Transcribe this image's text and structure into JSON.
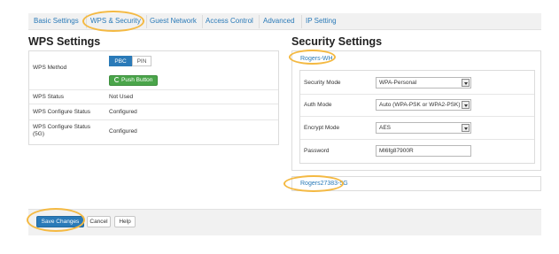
{
  "tabs": [
    {
      "label": "Basic Settings"
    },
    {
      "label": "WPS & Security"
    },
    {
      "label": "Guest Network"
    },
    {
      "label": "Access Control"
    },
    {
      "label": "Advanced"
    },
    {
      "label": "IP Setting"
    }
  ],
  "wps": {
    "title": "WPS Settings",
    "method_label": "WPS Method",
    "method_options": [
      "PBC",
      "PIN"
    ],
    "method_selected": "PBC",
    "push_button_label": "Push Button",
    "status_label": "WPS Status",
    "status_value": "Not Used",
    "configure_status_label": "WPS Configure Status",
    "configure_status_value": "Configured",
    "configure_status_5g_label": "WPS Configure Status (5G)",
    "configure_status_5g_value": "Configured"
  },
  "security": {
    "title": "Security Settings",
    "network_24": "Rogers-WH",
    "mode_label": "Security Mode",
    "mode_value": "WPA-Personal",
    "auth_label": "Auth Mode",
    "auth_value": "Auto (WPA-PSK or WPA2-PSK)",
    "encrypt_label": "Encrypt Mode",
    "encrypt_value": "AES",
    "password_label": "Password",
    "password_value": "Ml6fg87900R",
    "network_5g": "Rogers27383-5G"
  },
  "footer": {
    "save_label": "Save Changes",
    "cancel_label": "Cancel",
    "help_label": "Help"
  },
  "colors": {
    "accent": "#2a7ab8",
    "highlight_ring": "#f4b942",
    "success": "#4aa54a"
  }
}
